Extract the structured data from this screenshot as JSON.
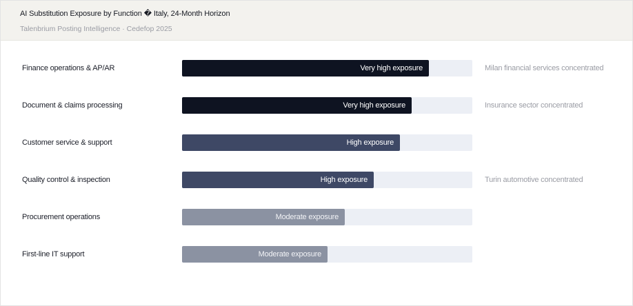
{
  "header": {
    "title": "AI Substitution Exposure by Function � Italy, 24-Month Horizon",
    "subtitle": "Talenbrium Posting Intelligence · Cedefop 2025"
  },
  "colors": {
    "very_high": "#0e1321",
    "high": "#3e4865",
    "moderate": "#8b92a2",
    "track": "#eceff5"
  },
  "chart_data": {
    "type": "bar",
    "orientation": "horizontal",
    "title": "AI Substitution Exposure by Function � Italy, 24-Month Horizon",
    "subtitle": "Talenbrium Posting Intelligence · Cedefop 2025",
    "xlim": [
      0,
      100
    ],
    "categories": [
      "Finance operations & AP/AR",
      "Document & claims processing",
      "Customer service & support",
      "Quality control & inspection",
      "Procurement operations",
      "First-line IT support"
    ],
    "values": [
      85,
      79,
      75,
      66,
      56,
      50
    ],
    "bar_labels": [
      "Very high exposure",
      "Very high exposure",
      "High exposure",
      "High exposure",
      "Moderate exposure",
      "Moderate exposure"
    ],
    "levels": [
      "very_high",
      "very_high",
      "high",
      "high",
      "moderate",
      "moderate"
    ],
    "annotations": [
      "Milan financial services concentrated",
      "Insurance sector concentrated",
      "",
      "Turin automotive concentrated",
      "",
      ""
    ]
  }
}
